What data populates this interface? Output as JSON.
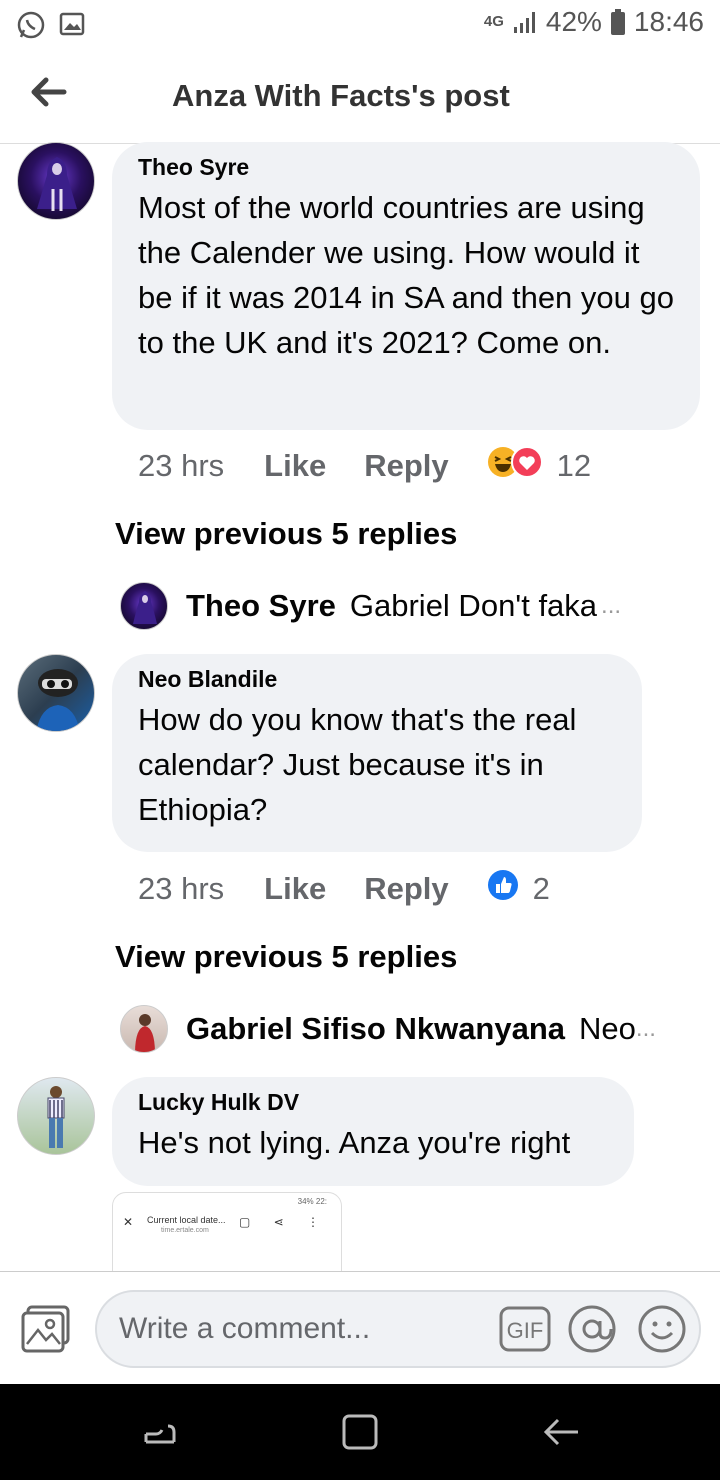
{
  "status_bar": {
    "network": "4G",
    "battery": "42%",
    "time": "18:46",
    "icons": [
      "whatsapp-icon",
      "gallery-icon",
      "signal-icon",
      "battery-icon"
    ]
  },
  "header": {
    "title": "Anza With Facts's post",
    "back_icon": "back-arrow-icon"
  },
  "comments": [
    {
      "author": "Theo Syre",
      "text": "Most of the world countries are using the Calender we using. How would it be if it was 2014 in SA and then you go to the UK and it's 2021? Come on.",
      "time": "23 hrs",
      "like_label": "Like",
      "reply_label": "Reply",
      "reactions": [
        "haha-icon",
        "love-icon"
      ],
      "reaction_count": "12",
      "view_previous": "View previous 5 replies",
      "latest_reply": {
        "author": "Theo Syre",
        "text": "Gabriel Don't faka",
        "ellipsis": "..."
      }
    },
    {
      "author": "Neo Blandile",
      "text": "How do you know that's the real calendar?  Just because it's in Ethiopia?",
      "time": "23 hrs",
      "like_label": "Like",
      "reply_label": "Reply",
      "reactions": [
        "like-reaction-icon"
      ],
      "reaction_count": "2",
      "view_previous": "View previous 5 replies",
      "latest_reply": {
        "author": "Gabriel Sifiso Nkwanyana",
        "text": "Neo",
        "ellipsis": "..."
      }
    },
    {
      "author": "Lucky Hulk DV",
      "text": "He's not lying. Anza you're right",
      "attachment": {
        "status": "34%  22:",
        "url": "Current local date...",
        "domain": "time.ertale.com"
      }
    }
  ],
  "composer": {
    "placeholder": "Write a comment...",
    "gif_label": "GIF"
  },
  "colors": {
    "bubble": "#f0f2f5",
    "meta_text": "#65676b",
    "like_blue": "#1877f2",
    "love_red": "#f33e58",
    "haha_yellow": "#f7b125"
  }
}
